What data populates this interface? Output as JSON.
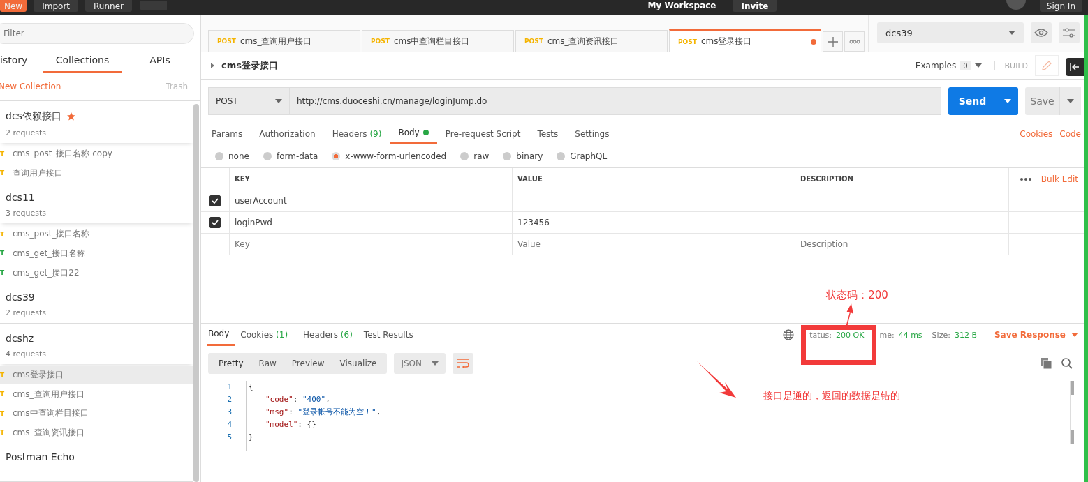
{
  "top_bar": {
    "buttons": [
      "New",
      "Import",
      "Runner"
    ],
    "workspace": "My Workspace",
    "invite": "Invite",
    "sign_in": "Sign In"
  },
  "sidebar": {
    "filter_placeholder": "Filter",
    "tabs": [
      {
        "label": "istory",
        "selected": false
      },
      {
        "label": "Collections",
        "selected": true
      },
      {
        "label": "APIs",
        "selected": false
      }
    ],
    "new_collection": "New Collection",
    "trash": "Trash",
    "collections": [
      {
        "name": "dcs依赖接口",
        "count": "2 requests",
        "starred": true,
        "expanded": true,
        "requests": [
          {
            "method": "T",
            "kind": "post",
            "name": "cms_post_接口名称 copy",
            "selected": false
          },
          {
            "method": "T",
            "kind": "post",
            "name": "查询用户接口",
            "selected": false
          }
        ]
      },
      {
        "name": "dcs11",
        "count": "3 requests",
        "starred": false,
        "expanded": true,
        "requests": [
          {
            "method": "T",
            "kind": "post",
            "name": "cms_post_接口名称",
            "selected": false
          },
          {
            "method": "T",
            "kind": "get",
            "name": "cms_get_接口名称",
            "selected": false
          },
          {
            "method": "T",
            "kind": "get",
            "name": "cms_get_接口22",
            "selected": false
          }
        ]
      },
      {
        "name": "dcs39",
        "count": "2 requests",
        "starred": false,
        "expanded": false
      },
      {
        "name": "dcshz",
        "count": "4 requests",
        "starred": false,
        "expanded": true,
        "requests": [
          {
            "method": "T",
            "kind": "post",
            "name": "cms登录接口",
            "selected": true
          },
          {
            "method": "T",
            "kind": "post",
            "name": "cms_查询用户接口",
            "selected": false
          },
          {
            "method": "T",
            "kind": "post",
            "name": "cms中查询栏目接口",
            "selected": false
          },
          {
            "method": "T",
            "kind": "post",
            "name": "cms_查询资讯接口",
            "selected": false
          }
        ]
      },
      {
        "name": "Postman Echo",
        "starred": false,
        "expanded": false
      }
    ]
  },
  "request_tabs": [
    {
      "method": "POST",
      "name": "cms_查询用户接口",
      "selected": false,
      "unsaved": false
    },
    {
      "method": "POST",
      "name": "cms中查询栏目接口",
      "selected": false,
      "unsaved": false
    },
    {
      "method": "POST",
      "name": "cms_查询资讯接口",
      "selected": false,
      "unsaved": false
    },
    {
      "method": "POST",
      "name": "cms登录接口",
      "selected": true,
      "unsaved": true
    }
  ],
  "environment": "dcs39",
  "request": {
    "title": "cms登录接口",
    "examples_label": "Examples",
    "examples_count": "0",
    "build": "BUILD",
    "method": "POST",
    "url": "http://cms.duoceshi.cn/manage/loginJump.do",
    "send": "Send",
    "save": "Save",
    "tabs": [
      {
        "label": "Params",
        "selected": false,
        "dot": false
      },
      {
        "label": "Authorization",
        "selected": false,
        "dot": false
      },
      {
        "label": "Headers",
        "count": "(9)",
        "selected": false,
        "dot": false
      },
      {
        "label": "Body",
        "selected": true,
        "dot": true
      },
      {
        "label": "Pre-request Script",
        "selected": false,
        "dot": false
      },
      {
        "label": "Tests",
        "selected": false,
        "dot": false
      },
      {
        "label": "Settings",
        "selected": false,
        "dot": false
      }
    ],
    "links": [
      "Cookies",
      "Code"
    ],
    "body_types": [
      {
        "label": "none",
        "selected": false
      },
      {
        "label": "form-data",
        "selected": false
      },
      {
        "label": "x-www-form-urlencoded",
        "selected": true
      },
      {
        "label": "raw",
        "selected": false
      },
      {
        "label": "binary",
        "selected": false
      },
      {
        "label": "GraphQL",
        "selected": false
      }
    ],
    "table": {
      "columns": [
        "KEY",
        "VALUE",
        "DESCRIPTION"
      ],
      "bulk_edit": "Bulk Edit",
      "rows": [
        {
          "checked": true,
          "key": "userAccount",
          "value": ""
        },
        {
          "checked": true,
          "key": "loginPwd",
          "value": "123456"
        }
      ],
      "placeholders": [
        "Key",
        "Value",
        "Description"
      ]
    }
  },
  "response": {
    "tabs": [
      {
        "label": "Body",
        "selected": true
      },
      {
        "label": "Cookies",
        "count": "(1)",
        "selected": false
      },
      {
        "label": "Headers",
        "count": "(6)",
        "selected": false
      },
      {
        "label": "Test Results",
        "selected": false
      }
    ],
    "status_label": "tatus:",
    "status": "200 OK",
    "time_label": "me:",
    "time": "44 ms",
    "size_label": "Size:",
    "size": "312 B",
    "save_response": "Save Response",
    "views": [
      {
        "label": "Pretty",
        "selected": true
      },
      {
        "label": "Raw",
        "selected": false
      },
      {
        "label": "Preview",
        "selected": false
      },
      {
        "label": "Visualize",
        "selected": false
      }
    ],
    "format": "JSON",
    "code": [
      [
        {
          "kind": "punct",
          "text": "{"
        }
      ],
      [
        {
          "kind": "key",
          "text": "\"code\""
        },
        {
          "kind": "punct",
          "text": ": "
        },
        {
          "kind": "string",
          "text": "\"400\""
        },
        {
          "kind": "punct",
          "text": ","
        }
      ],
      [
        {
          "kind": "key",
          "text": "\"msg\""
        },
        {
          "kind": "punct",
          "text": ": "
        },
        {
          "kind": "string",
          "text": "\"登录帐号不能为空！\""
        },
        {
          "kind": "punct",
          "text": ","
        }
      ],
      [
        {
          "kind": "key",
          "text": "\"model\""
        },
        {
          "kind": "punct",
          "text": ": {}"
        }
      ],
      [
        {
          "kind": "punct",
          "text": "}"
        }
      ]
    ],
    "line_numbers": [
      "1",
      "2",
      "3",
      "4",
      "5"
    ]
  },
  "annotations": {
    "status_note": "状态码：200",
    "note": "接口是通的，返回的数据是错的"
  }
}
